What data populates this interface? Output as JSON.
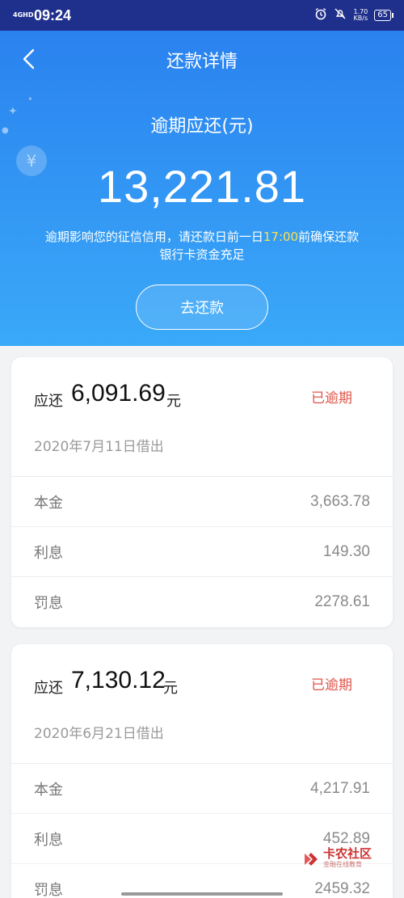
{
  "status_bar": {
    "network": "4GHD",
    "time": "09:24",
    "speed_value": "1.70",
    "speed_unit": "KB/s",
    "battery": "65"
  },
  "header": {
    "title": "还款详情"
  },
  "summary": {
    "label": "逾期应还(元)",
    "amount": "13,221.81",
    "notice_before": "逾期影响您的征信信用，请还款日前一日",
    "notice_time": "17:00",
    "notice_after": "前确保还款",
    "notice_line2": "银行卡资金充足",
    "repay_button": "去还款"
  },
  "loans": [
    {
      "due_label": "应还",
      "amount": "6,091.69",
      "unit": "元",
      "status": "已逾期",
      "date": "2020年7月11日借出",
      "rows": [
        {
          "label": "本金",
          "value": "3,663.78"
        },
        {
          "label": "利息",
          "value": "149.30"
        },
        {
          "label": "罚息",
          "value": "2278.61"
        }
      ]
    },
    {
      "due_label": "应还",
      "amount": "7,130.12",
      "unit": "元",
      "status": "已逾期",
      "date": "2020年6月21日借出",
      "rows": [
        {
          "label": "本金",
          "value": "4,217.91"
        },
        {
          "label": "利息",
          "value": "452.89"
        },
        {
          "label": "罚息",
          "value": "2459.32"
        }
      ]
    }
  ],
  "watermark": {
    "text": "卡农社区",
    "sub": "金融在线教育"
  },
  "colors": {
    "header_top": "#2a82ef",
    "header_bottom": "#3aa9f8",
    "status_bar": "#1f2f8c",
    "overdue_red": "#e0554a",
    "notice_highlight": "#ffe24a"
  }
}
